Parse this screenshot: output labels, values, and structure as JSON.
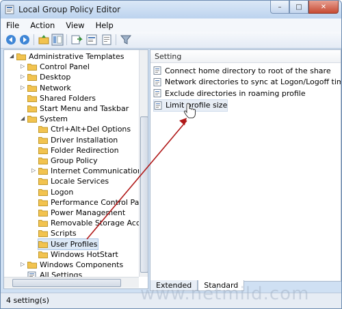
{
  "window": {
    "title": "Local Group Policy Editor",
    "minimize": "–",
    "maximize": "□",
    "close": "✕"
  },
  "menu": [
    "File",
    "Action",
    "View",
    "Help"
  ],
  "tree": {
    "items": [
      {
        "label": "Administrative Templates",
        "depth": 0,
        "expander": "◢"
      },
      {
        "label": "Control Panel",
        "depth": 1,
        "expander": "▷"
      },
      {
        "label": "Desktop",
        "depth": 1,
        "expander": "▷"
      },
      {
        "label": "Network",
        "depth": 1,
        "expander": "▷"
      },
      {
        "label": "Shared Folders",
        "depth": 1,
        "expander": ""
      },
      {
        "label": "Start Menu and Taskbar",
        "depth": 1,
        "expander": ""
      },
      {
        "label": "System",
        "depth": 1,
        "expander": "◢"
      },
      {
        "label": "Ctrl+Alt+Del Options",
        "depth": 2,
        "expander": ""
      },
      {
        "label": "Driver Installation",
        "depth": 2,
        "expander": ""
      },
      {
        "label": "Folder Redirection",
        "depth": 2,
        "expander": ""
      },
      {
        "label": "Group Policy",
        "depth": 2,
        "expander": ""
      },
      {
        "label": "Internet Communication Mar",
        "depth": 2,
        "expander": "▷"
      },
      {
        "label": "Locale Services",
        "depth": 2,
        "expander": ""
      },
      {
        "label": "Logon",
        "depth": 2,
        "expander": ""
      },
      {
        "label": "Performance Control Panel",
        "depth": 2,
        "expander": ""
      },
      {
        "label": "Power Management",
        "depth": 2,
        "expander": ""
      },
      {
        "label": "Removable Storage Access",
        "depth": 2,
        "expander": ""
      },
      {
        "label": "Scripts",
        "depth": 2,
        "expander": ""
      },
      {
        "label": "User Profiles",
        "depth": 2,
        "expander": "",
        "selected": true
      },
      {
        "label": "Windows HotStart",
        "depth": 2,
        "expander": ""
      },
      {
        "label": "Windows Components",
        "depth": 1,
        "expander": "▷"
      },
      {
        "label": "All Settings",
        "depth": 1,
        "expander": ""
      }
    ]
  },
  "settings": {
    "header": "Setting",
    "rows": [
      {
        "label": "Connect home directory to root of the share"
      },
      {
        "label": "Network directories to sync at Logon/Logoff time only"
      },
      {
        "label": "Exclude directories in roaming profile"
      },
      {
        "label": "Limit profile size",
        "selected": true
      }
    ]
  },
  "tabs": [
    "Extended",
    "Standard"
  ],
  "active_tab": "Standard",
  "status": "4 setting(s)",
  "watermark": "www.netmild.com",
  "colors": {
    "arrow": "#b01818",
    "folder": "#f2c34f",
    "selection": "#dce8f6"
  }
}
